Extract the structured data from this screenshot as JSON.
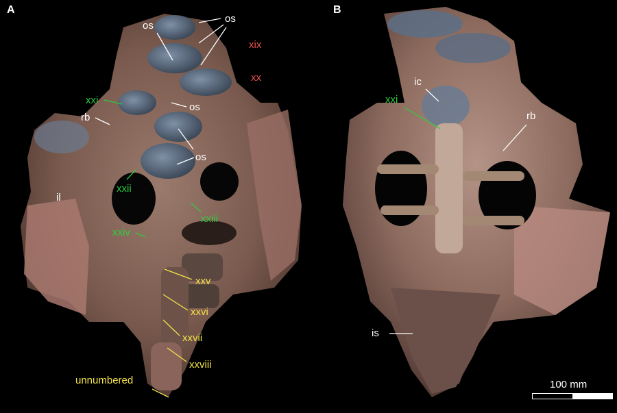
{
  "panels": {
    "a": {
      "letter": "A"
    },
    "b": {
      "letter": "B"
    }
  },
  "colors": {
    "white": "#ffffff",
    "green": "#2ecc40",
    "red": "#e8534c",
    "yellow": "#f2e24a",
    "bone_base": "#8a6a5a",
    "bone_blue": "#5a6e86",
    "matrix_pink": "#b07a72"
  },
  "labels_a": {
    "os_top_left": "os",
    "os_top_right": "os",
    "xix": "xix",
    "xx": "xx",
    "xxi": "xxi",
    "rb": "rb",
    "os_mid": "os",
    "os_low": "os",
    "il": "il",
    "xxii": "xxii",
    "xxiii": "xxiii",
    "xxiv": "xxiv",
    "xxv": "xxv",
    "xxvi": "xxvi",
    "xxvii": "xxvii",
    "xxviii": "xxviii",
    "unnumbered": "unnumbered"
  },
  "labels_b": {
    "ic": "ic",
    "xxi": "xxi",
    "rb": "rb",
    "is": "is"
  },
  "scale": {
    "label": "100 mm"
  }
}
